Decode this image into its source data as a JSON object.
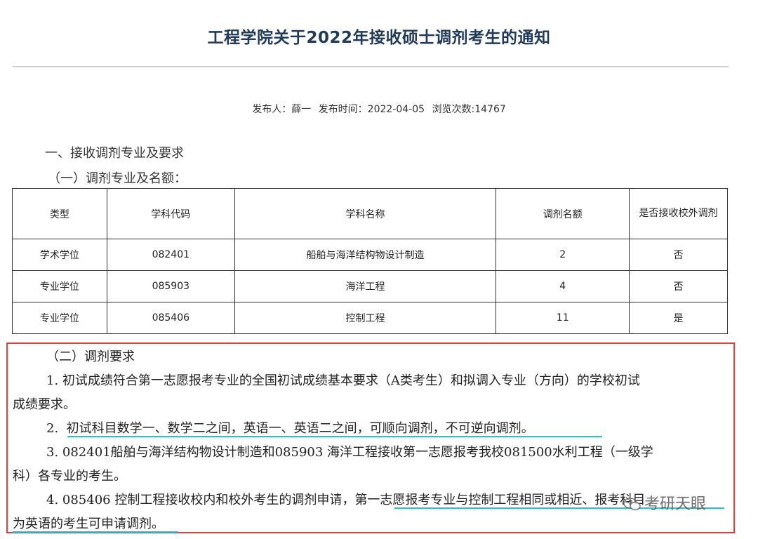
{
  "title": "工程学院关于2022年接收硕士调剂考生的通知",
  "meta": {
    "publisher": "发布人：薛一",
    "publish_time": "发布时间：2022-04-05",
    "views": "浏览次数:14767"
  },
  "section1": {
    "heading": "一、接收调剂专业及要求",
    "sub": "（一）调剂专业及名额："
  },
  "table": {
    "headers": [
      "类型",
      "学科代码",
      "学科名称",
      "调剂名额",
      "是否接收校外调剂"
    ],
    "rows": [
      [
        "学术学位",
        "082401",
        "船舶与海洋结构物设计制造",
        "2",
        "否"
      ],
      [
        "专业学位",
        "085903",
        "海洋工程",
        "4",
        "否"
      ],
      [
        "专业学位",
        "085406",
        "控制工程",
        "11",
        "是"
      ]
    ]
  },
  "section2": {
    "heading": "（二）调剂要求",
    "item1_line1": "1. 初试成绩符合第一志愿报考专业的全国初试成绩基本要求（A类考生）和拟调入专业（方向）的学校初试",
    "item1_line2": "成绩要求。",
    "item2_num": "2.",
    "item2_text": "初试科目数学一、数学二之间，英语一、英语二之间，可顺向调剂，不可逆向调剂。",
    "item3_line1": "3. 082401船舶与海洋结构物设计制造和085903 海洋工程接收第一志愿报考我校081500水利工程（一级学",
    "item3_line2": "科）各专业的考生。",
    "item4_line1_a": "4. 085406 控制工程接收校内和校外考生的调剂申请，",
    "item4_line1_b": "第一志愿报考专业与控制工程相同或相近、报考科目",
    "item4_line2": "为英语的考生可申请调剂。"
  },
  "watermark": "考研天眼",
  "colors": {
    "title": "#1f3a5a",
    "highlight_box": "#e0413f",
    "underline": "#27c4c4"
  }
}
